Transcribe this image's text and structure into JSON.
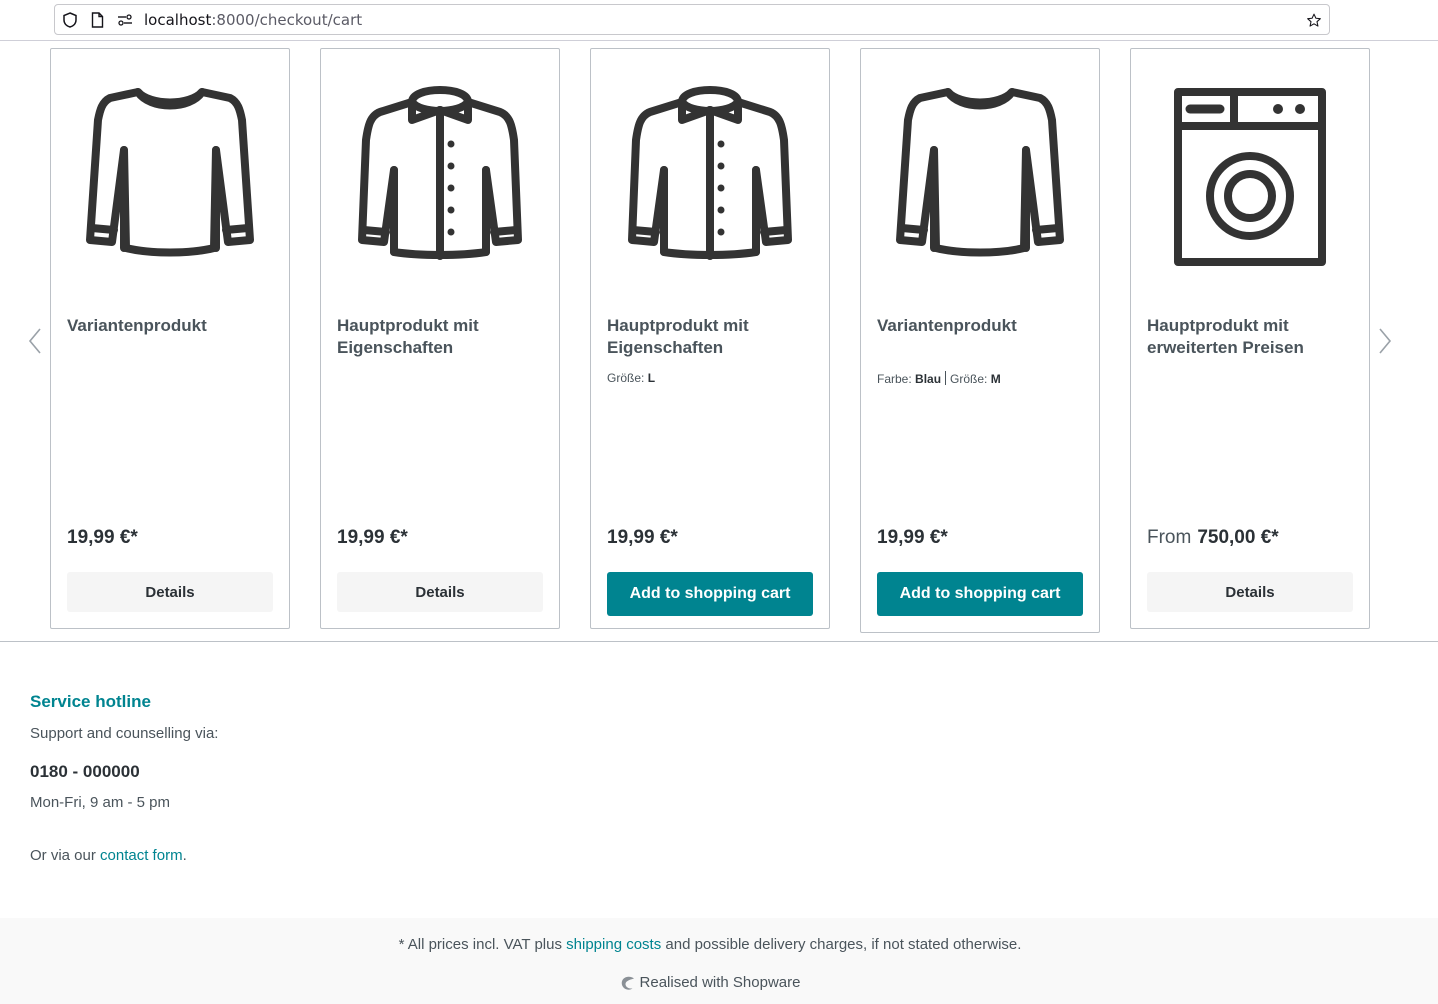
{
  "browser": {
    "url_host": "localhost",
    "url_path": ":8000/checkout/cart"
  },
  "carousel": {
    "products": [
      {
        "image_icon": "sweater-icon",
        "title": "Variantenprodukt",
        "properties": null,
        "price_prefix": "",
        "price": "19,99 €*",
        "button_label": "Details",
        "button_type": "details"
      },
      {
        "image_icon": "jacket-icon",
        "title": "Hauptprodukt mit Eigenschaften",
        "properties": null,
        "price_prefix": "",
        "price": "19,99 €*",
        "button_label": "Details",
        "button_type": "details"
      },
      {
        "image_icon": "jacket-icon",
        "title": "Hauptprodukt mit Eigenschaften",
        "properties": [
          {
            "label": "Größe:",
            "value": "L"
          }
        ],
        "price_prefix": "",
        "price": "19,99 €*",
        "button_label": "Add to shopping cart",
        "button_type": "cart"
      },
      {
        "image_icon": "sweater-icon",
        "title": "Variantenprodukt",
        "properties": [
          {
            "label": "Farbe:",
            "value": "Blau"
          },
          {
            "label": "Größe:",
            "value": "M"
          }
        ],
        "price_prefix": "",
        "price": "19,99 €*",
        "button_label": "Add to shopping cart",
        "button_type": "cart"
      },
      {
        "image_icon": "washing-machine-icon",
        "title": "Hauptprodukt mit erweiterten Preisen",
        "properties": null,
        "price_prefix": "From",
        "price": "750,00 €*",
        "button_label": "Details",
        "button_type": "details"
      }
    ]
  },
  "service": {
    "title": "Service hotline",
    "subtitle": "Support and counselling via:",
    "phone": "0180 - 000000",
    "hours": "Mon-Fri, 9 am - 5 pm",
    "contact_prefix": "Or via our ",
    "contact_link": "contact form",
    "contact_suffix": "."
  },
  "footer": {
    "vat_prefix": "* All prices incl. VAT plus ",
    "vat_link": "shipping costs",
    "vat_suffix": " and possible delivery charges, if not stated otherwise.",
    "realised": "Realised with Shopware"
  },
  "colors": {
    "accent": "#008490",
    "text": "#4a545b",
    "dark_text": "#2b3136",
    "icon": "#333333"
  }
}
